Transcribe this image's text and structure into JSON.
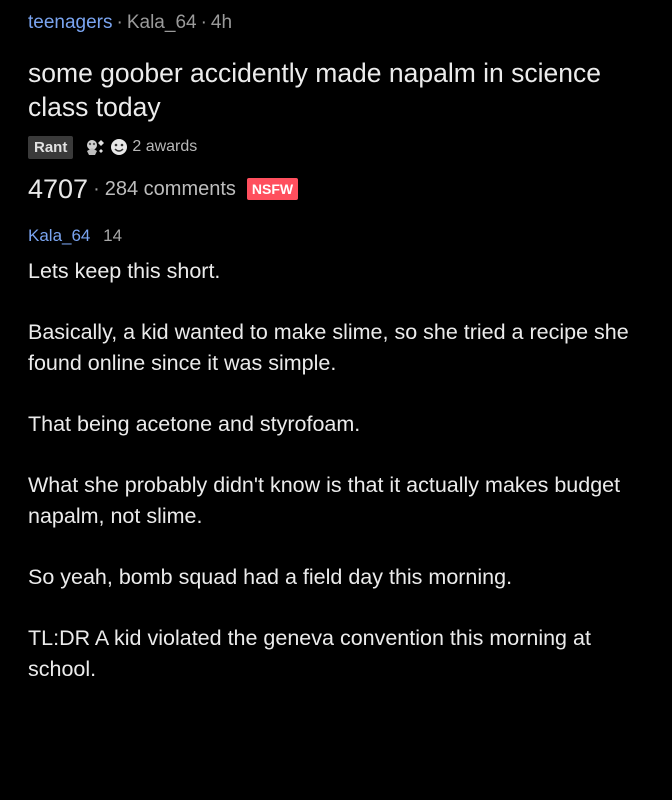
{
  "post": {
    "subreddit": "teenagers",
    "author": "Kala_64",
    "age": "4h",
    "separator": "·",
    "title": "some goober accidently made napalm in science class today",
    "flair": "Rant",
    "awards_label": "2 awards",
    "score": "4707",
    "comments_label": "284 comments",
    "nsfw_label": "NSFW"
  },
  "comment": {
    "author": "Kala_64",
    "points": "14",
    "paragraphs": [
      "Lets keep this short.",
      "Basically, a kid wanted to make slime, so she tried a recipe she found online since it was simple.",
      "That being acetone and styrofoam.",
      "What she probably didn't know is that it actually makes budget napalm, not slime.",
      "So yeah, bomb squad had a field day this morning.",
      "TL:DR A kid violated the geneva convention this morning at school."
    ]
  },
  "icons": {
    "award_1": "award-icon",
    "award_2": "award-icon"
  },
  "colors": {
    "background": "#000000",
    "link_blue": "#7aa4f0",
    "nsfw_red": "#ff4f5e",
    "flair_bg": "#3a3a3a"
  }
}
